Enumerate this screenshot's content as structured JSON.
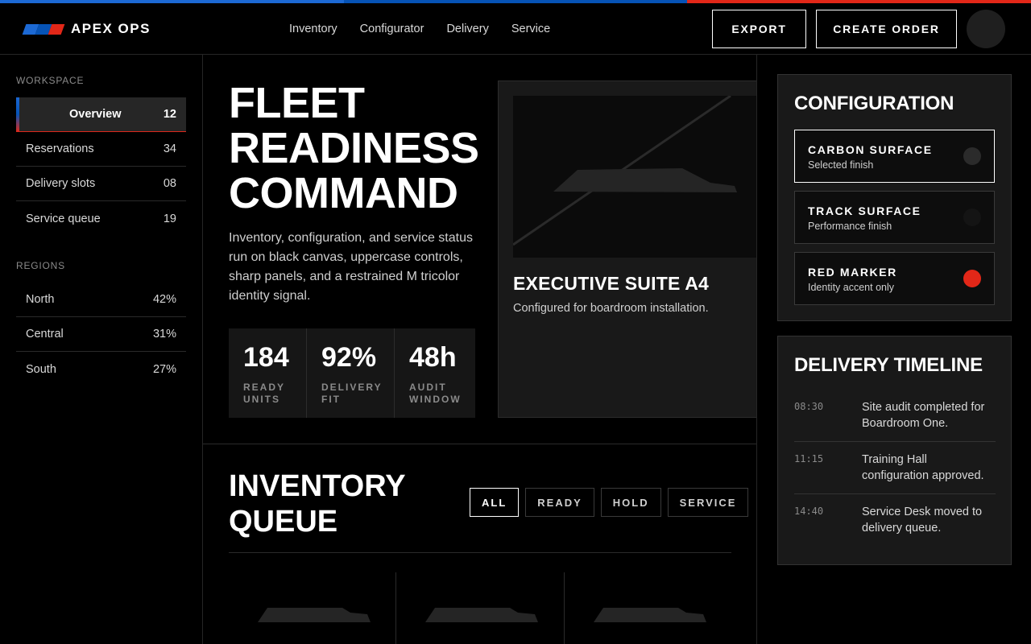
{
  "brand": {
    "name": "APEX OPS",
    "colors": [
      "#1c69d4",
      "#0653b6",
      "#e22718"
    ]
  },
  "nav": [
    "Inventory",
    "Configurator",
    "Delivery",
    "Service"
  ],
  "actions": {
    "export": "EXPORT",
    "create": "CREATE ORDER"
  },
  "sidebar": {
    "workspace_heading": "WORKSPACE",
    "workspace": [
      {
        "label": "Overview",
        "count": "12"
      },
      {
        "label": "Reservations",
        "count": "34"
      },
      {
        "label": "Delivery slots",
        "count": "08"
      },
      {
        "label": "Service queue",
        "count": "19"
      }
    ],
    "regions_heading": "REGIONS",
    "regions": [
      {
        "label": "North",
        "value": "42%"
      },
      {
        "label": "Central",
        "value": "31%"
      },
      {
        "label": "South",
        "value": "27%"
      }
    ]
  },
  "hero": {
    "title_lines": [
      "FLEET",
      "READINESS",
      "COMMAND"
    ],
    "description": "Inventory, configuration, and service status run on black canvas, uppercase controls, sharp panels, and a restrained M tricolor identity signal.",
    "stats": [
      {
        "value": "184",
        "label": "READY UNITS"
      },
      {
        "value": "92%",
        "label": "DELIVERY FIT"
      },
      {
        "value": "48h",
        "label": "AUDIT WINDOW"
      }
    ]
  },
  "feature": {
    "title": "EXECUTIVE SUITE A4",
    "subtitle": "Configured for boardroom installation."
  },
  "inventory": {
    "title_lines": [
      "INVENTORY",
      "QUEUE"
    ],
    "filters": [
      "ALL",
      "READY",
      "HOLD",
      "SERVICE"
    ]
  },
  "configuration": {
    "title": "CONFIGURATION",
    "options": [
      {
        "name": "CARBON SURFACE",
        "desc": "Selected finish",
        "color": "#2b2b2b"
      },
      {
        "name": "TRACK SURFACE",
        "desc": "Performance finish",
        "color": "#141414"
      },
      {
        "name": "RED MARKER",
        "desc": "Identity accent only",
        "color": "#e22718"
      }
    ]
  },
  "delivery": {
    "title": "DELIVERY TIMELINE",
    "events": [
      {
        "time": "08:30",
        "text": "Site audit completed for Boardroom One."
      },
      {
        "time": "11:15",
        "text": "Training Hall configuration approved."
      },
      {
        "time": "14:40",
        "text": "Service Desk moved to delivery queue."
      }
    ]
  }
}
